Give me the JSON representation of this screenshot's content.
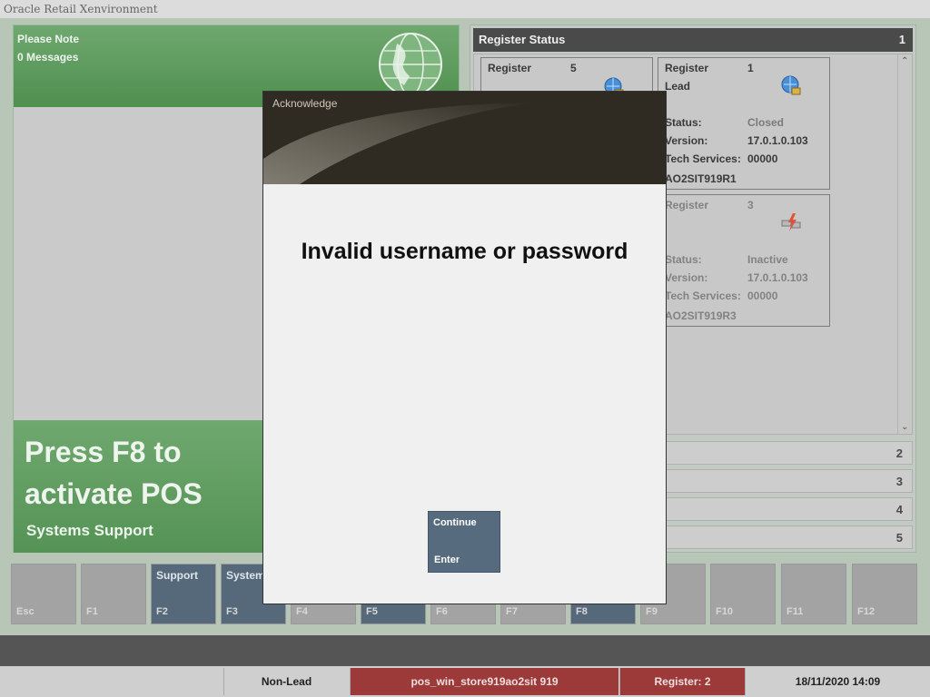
{
  "window": {
    "title": "Oracle Retail Xenvironment"
  },
  "left_panel": {
    "note_title": "Please Note",
    "messages": "0 Messages",
    "activate_text": "Press F8 to activate POS",
    "support_text": "Systems Support"
  },
  "register_status": {
    "title": "Register Status",
    "index": "1",
    "cards": [
      {
        "label": "Register",
        "number": "5",
        "icon": "network-globe-icon",
        "state": "online"
      },
      {
        "label": "Register",
        "number": "1",
        "lead": "Lead",
        "status_label": "Status:",
        "status": "Closed",
        "version_label": "Version:",
        "version": "17.0.1.0.103",
        "tech_label": "Tech Services:",
        "tech": "00000",
        "host": "AO2SIT919R1",
        "icon": "network-globe-icon",
        "state": "online"
      },
      {
        "label": "Register",
        "number": "3",
        "status_label": "Status:",
        "status": "Inactive",
        "version_label": "Version:",
        "version": "17.0.1.0.103",
        "tech_label": "Tech Services:",
        "tech": "00000",
        "host": "AO2SIT919R3",
        "icon": "disconnected-icon",
        "state": "inactive"
      }
    ],
    "sections": [
      "2",
      "3",
      "4",
      "5"
    ]
  },
  "fkeys": [
    {
      "top": "",
      "key": "Esc",
      "active": false
    },
    {
      "top": "",
      "key": "F1",
      "active": false
    },
    {
      "top": "Support",
      "key": "F2",
      "active": true
    },
    {
      "top": "System",
      "key": "F3",
      "active": true
    },
    {
      "top": "",
      "key": "F4",
      "active": false
    },
    {
      "top": "",
      "key": "F5",
      "active": true
    },
    {
      "top": "",
      "key": "F6",
      "active": false
    },
    {
      "top": "",
      "key": "F7",
      "active": false
    },
    {
      "top": "",
      "key": "F8",
      "active": true
    },
    {
      "top": "",
      "key": "F9",
      "active": false
    },
    {
      "top": "",
      "key": "F10",
      "active": false
    },
    {
      "top": "",
      "key": "F11",
      "active": false
    },
    {
      "top": "",
      "key": "F12",
      "active": false
    }
  ],
  "status_bar": {
    "role": "Non-Lead",
    "store": "pos_win_store919ao2sit 919",
    "register": "Register: 2",
    "datetime": "18/11/2020 14:09"
  },
  "dialog": {
    "title": "Acknowledge",
    "message": "Invalid username or password",
    "button_label": "Continue",
    "button_key": "Enter"
  },
  "colors": {
    "accent_green": "#5f9a5f",
    "fkey_active": "#56697b",
    "status_red": "#9c3a3a",
    "dialog_header": "#2f2a22"
  }
}
